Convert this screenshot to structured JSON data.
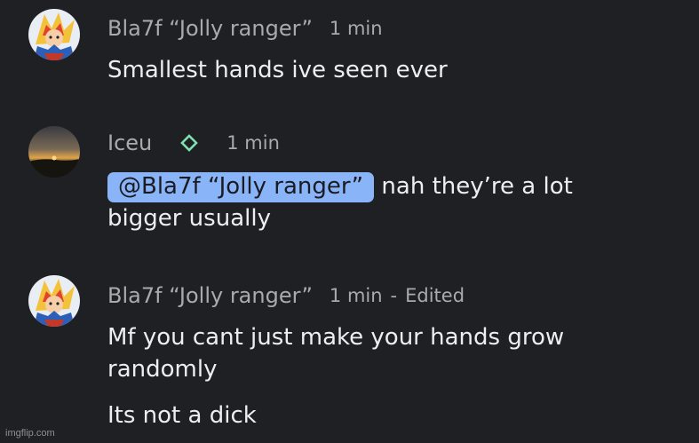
{
  "messages": [
    {
      "author": "Bla7f “Jolly ranger”",
      "time": "1 min",
      "lines": [
        "Smallest hands ive seen ever"
      ],
      "avatar_icon": "anime-character-avatar"
    },
    {
      "author": "Iceu",
      "badge_icon": "diamond-badge-icon",
      "badge_color": "#7fe0b0",
      "time": "1 min",
      "mention": "@Bla7f “Jolly ranger”",
      "line1_rest": " nah they’re a lot",
      "line2": "bigger usually",
      "avatar_icon": "sunset-avatar"
    },
    {
      "author": "Bla7f “Jolly ranger”",
      "time": "1 min",
      "separator": "-",
      "edited": "Edited",
      "line1": "Mf you cant just make your hands grow",
      "line2": "randomly",
      "line3": "Its not a dick",
      "avatar_icon": "anime-character-avatar"
    }
  ],
  "watermark": "imgflip.com",
  "colors": {
    "background": "#1f2024",
    "mention_bg": "#8ab4f8",
    "meta_text": "#a9aab0"
  }
}
